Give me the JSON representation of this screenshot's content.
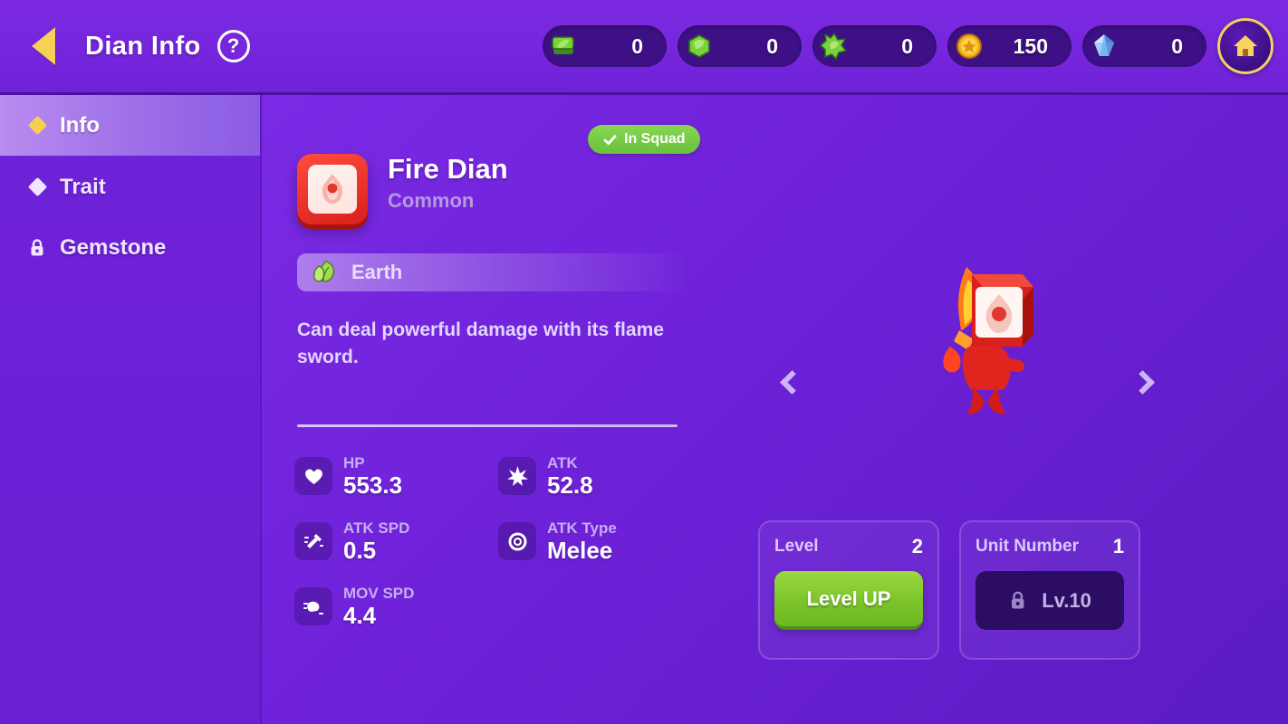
{
  "header": {
    "back_icon": "back-triangle-icon",
    "title": "Dian Info",
    "help_label": "?",
    "home_icon": "home-icon",
    "currencies": [
      {
        "icon": "green-leaf-stack-icon",
        "value": "0"
      },
      {
        "icon": "green-gem-icon",
        "value": "0"
      },
      {
        "icon": "green-star-burst-icon",
        "value": "0"
      },
      {
        "icon": "gold-star-coin-icon",
        "value": "150"
      },
      {
        "icon": "blue-diamond-icon",
        "value": "0"
      }
    ]
  },
  "sidebar": {
    "items": [
      {
        "label": "Info",
        "icon": "diamond-gold-icon",
        "active": true
      },
      {
        "label": "Trait",
        "icon": "diamond-white-icon",
        "active": false
      },
      {
        "label": "Gemstone",
        "icon": "lock-icon",
        "active": false
      }
    ]
  },
  "character": {
    "portrait_icon": "fire-emblem-icon",
    "name": "Fire Dian",
    "rarity": "Common",
    "squad_badge": {
      "label": "In Squad",
      "icon": "check-icon"
    },
    "element": {
      "label": "Earth",
      "icon": "leaf-icon"
    },
    "description": "Can deal powerful damage with its flame sword."
  },
  "stats": {
    "left": [
      {
        "icon": "heart-icon",
        "label": "HP",
        "value": "553.3"
      },
      {
        "icon": "attack-speed-icon",
        "label": "ATK SPD",
        "value": "0.5"
      },
      {
        "icon": "move-speed-icon",
        "label": "MOV SPD",
        "value": "4.4"
      }
    ],
    "right": [
      {
        "icon": "star-burst-icon",
        "label": "ATK",
        "value": "52.8"
      },
      {
        "icon": "target-icon",
        "label": "ATK Type",
        "value": "Melee"
      }
    ]
  },
  "preview": {
    "prev_icon": "chevron-left-icon",
    "next_icon": "chevron-right-icon",
    "character_model": "fire-dian-model"
  },
  "panels": {
    "level": {
      "label": "Level",
      "value": "2",
      "button": "Level UP"
    },
    "unit": {
      "label": "Unit Number",
      "value": "1",
      "button": "Lv.10",
      "locked_icon": "lock-icon"
    }
  },
  "colors": {
    "background": "#6b1fd6",
    "header": "#7a29e0",
    "accent_gold": "#f6ce52",
    "green_button": "#7cc42b",
    "badge_green": "#69c23c",
    "rarity_text": "#b69ae0"
  }
}
